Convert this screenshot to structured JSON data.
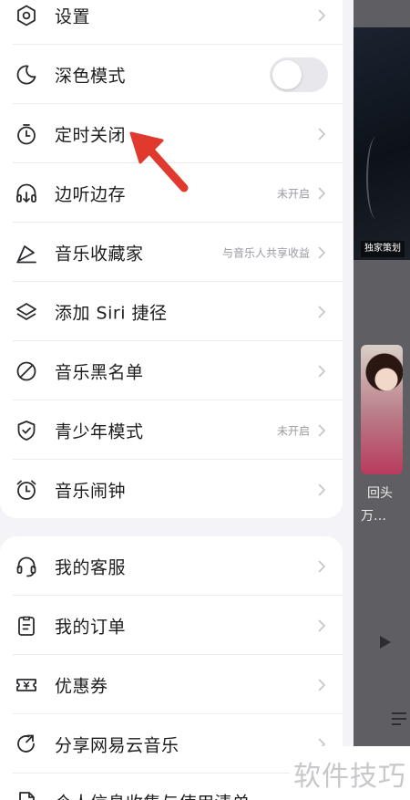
{
  "background": {
    "badge": "独家策划",
    "text_line1": "回头",
    "text_line2": "万…"
  },
  "menu_section1": [
    {
      "label": "设置",
      "icon": "settings-hex-icon"
    },
    {
      "label": "深色模式",
      "icon": "moon-icon",
      "toggle_on": false
    },
    {
      "label": "定时关闭",
      "icon": "timer-icon"
    },
    {
      "label": "边听边存",
      "icon": "headphone-download-icon",
      "sub": "未开启"
    },
    {
      "label": "音乐收藏家",
      "icon": "collector-icon",
      "sub": "与音乐人共享收益"
    },
    {
      "label": "添加 Siri 捷径",
      "icon": "layers-icon"
    },
    {
      "label": "音乐黑名单",
      "icon": "block-icon"
    },
    {
      "label": "青少年模式",
      "icon": "shield-check-icon",
      "sub": "未开启"
    },
    {
      "label": "音乐闹钟",
      "icon": "alarm-clock-icon"
    }
  ],
  "menu_section2": [
    {
      "label": "我的客服",
      "icon": "headset-icon"
    },
    {
      "label": "我的订单",
      "icon": "clipboard-icon"
    },
    {
      "label": "优惠券",
      "icon": "coupon-icon"
    },
    {
      "label": "分享网易云音乐",
      "icon": "share-icon"
    },
    {
      "label": "个人信息收集与使用清单",
      "icon": "document-icon"
    }
  ],
  "watermark": "软件技巧",
  "colors": {
    "arrow": "#e03a2f",
    "icon_stroke": "#2a2a2e"
  }
}
